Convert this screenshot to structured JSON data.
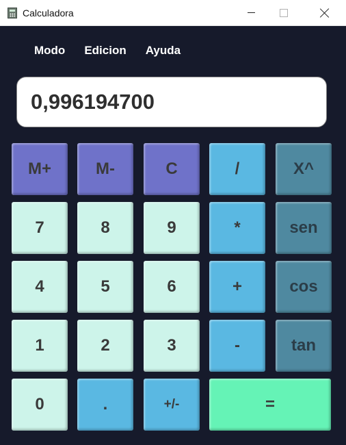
{
  "window": {
    "title": "Calculadora",
    "icon": "calculator-icon",
    "controls": [
      "minimize-icon",
      "maximize-icon",
      "close-icon"
    ]
  },
  "menu": {
    "items": [
      "Modo",
      "Edicion",
      "Ayuda"
    ]
  },
  "display": {
    "value": "0,996194700"
  },
  "keys": {
    "row1": [
      "M+",
      "M-",
      "C",
      "/",
      "X^"
    ],
    "row2": [
      "7",
      "8",
      "9",
      "*",
      "sen"
    ],
    "row3": [
      "4",
      "5",
      "6",
      "+",
      "cos"
    ],
    "row4": [
      "1",
      "2",
      "3",
      "-",
      "tan"
    ],
    "row5": [
      "0",
      ".",
      "+/-",
      "="
    ]
  },
  "colors": {
    "background": "#161a2b",
    "memory_keys": "#6f72c9",
    "operator_keys": "#5ab8e2",
    "function_keys": "#4f89a0",
    "number_keys": "#cdf4ea",
    "equals_key": "#65f3b6"
  }
}
